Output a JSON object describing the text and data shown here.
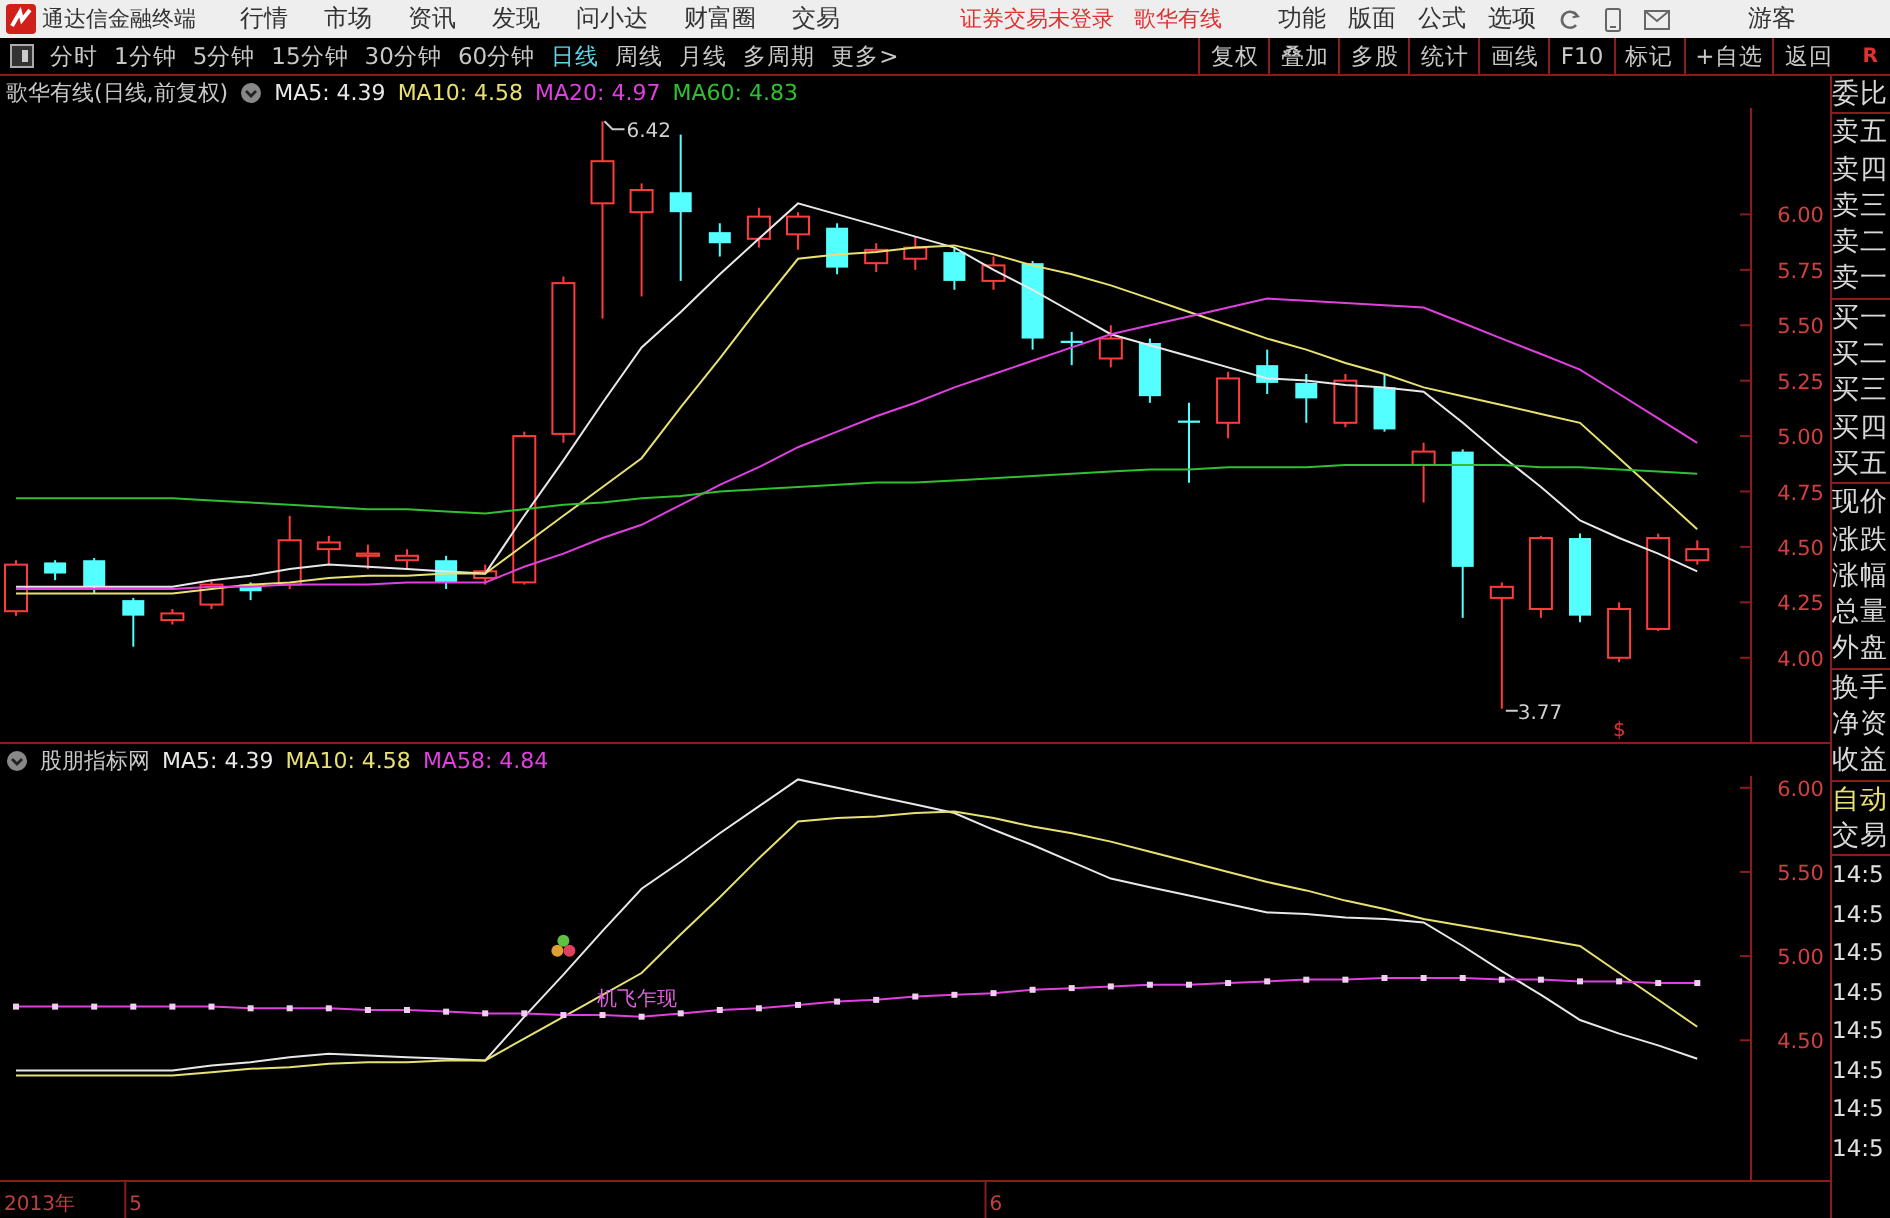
{
  "app": {
    "title": "通达信金融终端",
    "menus": [
      "行情",
      "市场",
      "资讯",
      "发现",
      "问小达",
      "财富圈",
      "交易"
    ],
    "notices": [
      "证券交易未登录",
      "歌华有线"
    ],
    "right_menus": [
      "功能",
      "版面",
      "公式",
      "选项"
    ],
    "user": "游客"
  },
  "periods": [
    {
      "label": "分时",
      "selected": false
    },
    {
      "label": "1分钟",
      "selected": false
    },
    {
      "label": "5分钟",
      "selected": false
    },
    {
      "label": "15分钟",
      "selected": false
    },
    {
      "label": "30分钟",
      "selected": false
    },
    {
      "label": "60分钟",
      "selected": false
    },
    {
      "label": "日线",
      "selected": true
    },
    {
      "label": "周线",
      "selected": false
    },
    {
      "label": "月线",
      "selected": false
    },
    {
      "label": "多周期",
      "selected": false
    },
    {
      "label": "更多>",
      "selected": false
    }
  ],
  "tools": [
    "复权",
    "叠加",
    "多股",
    "统计",
    "画线",
    "F10",
    "标记",
    "+自选",
    "返回"
  ],
  "corner_mark": "R",
  "main_chart": {
    "title": "歌华有线(日线,前复权)",
    "high_label": "6.42",
    "low_label": "3.77",
    "marker": "$",
    "chart_data": {
      "type": "candlestick",
      "ohlc": [
        [
          4.21,
          4.44,
          4.19,
          4.42
        ],
        [
          4.43,
          4.44,
          4.35,
          4.38
        ],
        [
          4.44,
          4.45,
          4.29,
          4.32
        ],
        [
          4.26,
          4.27,
          4.05,
          4.19
        ],
        [
          4.17,
          4.22,
          4.15,
          4.2
        ],
        [
          4.24,
          4.35,
          4.22,
          4.33
        ],
        [
          4.33,
          4.34,
          4.26,
          4.3
        ],
        [
          4.33,
          4.64,
          4.31,
          4.53
        ],
        [
          4.49,
          4.55,
          4.42,
          4.52
        ],
        [
          4.46,
          4.51,
          4.4,
          4.47
        ],
        [
          4.44,
          4.49,
          4.4,
          4.46
        ],
        [
          4.44,
          4.46,
          4.31,
          4.34
        ],
        [
          4.36,
          4.42,
          4.33,
          4.39
        ],
        [
          4.34,
          5.02,
          4.33,
          5.0
        ],
        [
          5.01,
          5.72,
          4.97,
          5.69
        ],
        [
          6.05,
          6.42,
          5.53,
          6.24
        ],
        [
          6.01,
          6.14,
          5.63,
          6.11
        ],
        [
          6.1,
          6.36,
          5.7,
          6.01
        ],
        [
          5.92,
          5.96,
          5.81,
          5.87
        ],
        [
          5.89,
          6.03,
          5.85,
          5.99
        ],
        [
          5.91,
          6.01,
          5.84,
          5.99
        ],
        [
          5.94,
          5.96,
          5.73,
          5.76
        ],
        [
          5.78,
          5.87,
          5.74,
          5.84
        ],
        [
          5.8,
          5.9,
          5.75,
          5.85
        ],
        [
          5.83,
          5.85,
          5.66,
          5.7
        ],
        [
          5.7,
          5.81,
          5.66,
          5.77
        ],
        [
          5.78,
          5.79,
          5.39,
          5.44
        ],
        [
          5.43,
          5.47,
          5.32,
          5.42
        ],
        [
          5.35,
          5.5,
          5.31,
          5.44
        ],
        [
          5.42,
          5.44,
          5.15,
          5.18
        ],
        [
          5.07,
          5.15,
          4.79,
          5.06
        ],
        [
          5.06,
          5.29,
          4.99,
          5.26
        ],
        [
          5.32,
          5.39,
          5.19,
          5.24
        ],
        [
          5.24,
          5.28,
          5.06,
          5.17
        ],
        [
          5.06,
          5.28,
          5.04,
          5.25
        ],
        [
          5.22,
          5.28,
          5.02,
          5.03
        ],
        [
          4.87,
          4.97,
          4.7,
          4.93
        ],
        [
          4.93,
          4.94,
          4.18,
          4.41
        ],
        [
          4.27,
          4.34,
          3.77,
          4.32
        ],
        [
          4.22,
          4.55,
          4.18,
          4.54
        ],
        [
          4.54,
          4.56,
          4.16,
          4.19
        ],
        [
          4.0,
          4.25,
          3.98,
          4.22
        ],
        [
          4.13,
          4.56,
          4.12,
          4.54
        ],
        [
          4.44,
          4.53,
          4.42,
          4.49
        ]
      ],
      "series": [
        {
          "name": "MA5: 4.39",
          "type": "line",
          "color": "#e8e8e8",
          "values": [
            4.32,
            4.32,
            4.32,
            4.32,
            4.32,
            4.35,
            4.37,
            4.4,
            4.42,
            4.41,
            4.4,
            4.39,
            4.38,
            4.64,
            4.89,
            5.15,
            5.4,
            5.56,
            5.73,
            5.89,
            6.05,
            6.0,
            5.95,
            5.9,
            5.85,
            5.75,
            5.66,
            5.56,
            5.46,
            5.41,
            5.36,
            5.31,
            5.26,
            5.25,
            5.23,
            5.22,
            5.2,
            5.06,
            4.91,
            4.77,
            4.62,
            4.54,
            4.47,
            4.39
          ]
        },
        {
          "name": "MA10: 4.58",
          "type": "line",
          "color": "#e8e070",
          "values": [
            4.29,
            4.29,
            4.29,
            4.29,
            4.29,
            4.31,
            4.33,
            4.34,
            4.36,
            4.37,
            4.37,
            4.38,
            4.38,
            4.51,
            4.64,
            4.77,
            4.9,
            5.13,
            5.35,
            5.58,
            5.8,
            5.82,
            5.83,
            5.85,
            5.86,
            5.82,
            5.77,
            5.73,
            5.68,
            5.62,
            5.56,
            5.5,
            5.44,
            5.39,
            5.33,
            5.28,
            5.22,
            5.18,
            5.14,
            5.1,
            5.06,
            4.9,
            4.74,
            4.58
          ]
        },
        {
          "name": "MA20: 4.97",
          "type": "line",
          "color": "#e040e0",
          "values": [
            4.31,
            4.31,
            4.31,
            4.31,
            4.31,
            4.32,
            4.32,
            4.33,
            4.33,
            4.33,
            4.34,
            4.34,
            4.34,
            4.41,
            4.47,
            4.54,
            4.6,
            4.69,
            4.78,
            4.86,
            4.95,
            5.02,
            5.09,
            5.15,
            5.22,
            5.28,
            5.34,
            5.4,
            5.46,
            5.5,
            5.54,
            5.58,
            5.62,
            5.61,
            5.6,
            5.59,
            5.58,
            5.51,
            5.44,
            5.37,
            5.3,
            5.19,
            5.08,
            4.97
          ]
        },
        {
          "name": "MA60: 4.83",
          "type": "line",
          "color": "#30c030",
          "values": [
            4.72,
            4.72,
            4.72,
            4.72,
            4.72,
            4.71,
            4.7,
            4.69,
            4.68,
            4.67,
            4.67,
            4.66,
            4.65,
            4.67,
            4.69,
            4.7,
            4.72,
            4.73,
            4.75,
            4.76,
            4.77,
            4.78,
            4.79,
            4.79,
            4.8,
            4.81,
            4.82,
            4.83,
            4.84,
            4.85,
            4.85,
            4.86,
            4.86,
            4.86,
            4.87,
            4.87,
            4.87,
            4.87,
            4.87,
            4.86,
            4.86,
            4.85,
            4.84,
            4.83
          ]
        }
      ],
      "ylim": [
        3.62,
        6.48
      ],
      "yticks": [
        {
          "value": 6,
          "label": "6.00"
        },
        {
          "value": 5.75,
          "label": "5.75"
        },
        {
          "value": 5.5,
          "label": "5.50"
        },
        {
          "value": 5.25,
          "label": "5.25"
        },
        {
          "value": 5,
          "label": "5.00"
        },
        {
          "value": 4.75,
          "label": "4.75"
        },
        {
          "value": 4.5,
          "label": "4.50"
        },
        {
          "value": 4.25,
          "label": "4.25"
        },
        {
          "value": 4,
          "label": "4.00"
        }
      ]
    }
  },
  "sub_chart": {
    "title": "股朋指标网",
    "signal": {
      "text": "机飞乍现"
    },
    "chart_data": {
      "type": "line",
      "series": [
        {
          "name": "MA5: 4.39",
          "color": "#e8e8e8",
          "values": [
            4.32,
            4.32,
            4.32,
            4.32,
            4.32,
            4.35,
            4.37,
            4.4,
            4.42,
            4.41,
            4.4,
            4.39,
            4.38,
            4.64,
            4.89,
            5.15,
            5.4,
            5.56,
            5.73,
            5.89,
            6.05,
            6.0,
            5.95,
            5.9,
            5.85,
            5.75,
            5.66,
            5.56,
            5.46,
            5.41,
            5.36,
            5.31,
            5.26,
            5.25,
            5.23,
            5.22,
            5.2,
            5.06,
            4.91,
            4.77,
            4.62,
            4.54,
            4.47,
            4.39
          ]
        },
        {
          "name": "MA10: 4.58",
          "color": "#e8e070",
          "values": [
            4.29,
            4.29,
            4.29,
            4.29,
            4.29,
            4.31,
            4.33,
            4.34,
            4.36,
            4.37,
            4.37,
            4.38,
            4.38,
            4.51,
            4.64,
            4.77,
            4.9,
            5.13,
            5.35,
            5.58,
            5.8,
            5.82,
            5.83,
            5.85,
            5.86,
            5.82,
            5.77,
            5.73,
            5.68,
            5.62,
            5.56,
            5.5,
            5.44,
            5.39,
            5.33,
            5.28,
            5.22,
            5.18,
            5.14,
            5.1,
            5.06,
            4.9,
            4.74,
            4.58
          ]
        },
        {
          "name": "MA58: 4.84",
          "color": "#e040e0",
          "marker": "square",
          "values": [
            4.7,
            4.7,
            4.7,
            4.7,
            4.7,
            4.7,
            4.69,
            4.69,
            4.69,
            4.68,
            4.68,
            4.67,
            4.66,
            4.66,
            4.65,
            4.65,
            4.64,
            4.66,
            4.68,
            4.69,
            4.71,
            4.73,
            4.74,
            4.76,
            4.77,
            4.78,
            4.8,
            4.81,
            4.82,
            4.83,
            4.83,
            4.84,
            4.85,
            4.86,
            4.86,
            4.87,
            4.87,
            4.87,
            4.86,
            4.86,
            4.85,
            4.85,
            4.84,
            4.84
          ]
        }
      ],
      "ylim": [
        3.67,
        6.07
      ],
      "yticks": [
        {
          "value": 6,
          "label": "6.00"
        },
        {
          "value": 5.5,
          "label": "5.50"
        },
        {
          "value": 5,
          "label": "5.00"
        },
        {
          "value": 4.5,
          "label": "4.50"
        }
      ]
    }
  },
  "date_labels": [
    "2013年",
    "5",
    "6"
  ],
  "quote_panel": {
    "groups": [
      [
        "委比"
      ],
      [
        "卖五",
        "卖四",
        "卖三",
        "卖二",
        "卖一"
      ],
      [
        "买一",
        "买二",
        "买三",
        "买四",
        "买五"
      ],
      [
        "现价",
        "涨跌",
        "涨幅",
        "总量",
        "外盘"
      ],
      [
        "换手",
        "净资",
        "收益"
      ]
    ],
    "trade_tabs": [
      {
        "label": "自动",
        "selected": true
      },
      {
        "label": "交易",
        "selected": false
      }
    ],
    "times": [
      "14:5",
      "14:5",
      "14:5",
      "14:5",
      "14:5",
      "14:5",
      "14:5",
      "14:5"
    ]
  }
}
